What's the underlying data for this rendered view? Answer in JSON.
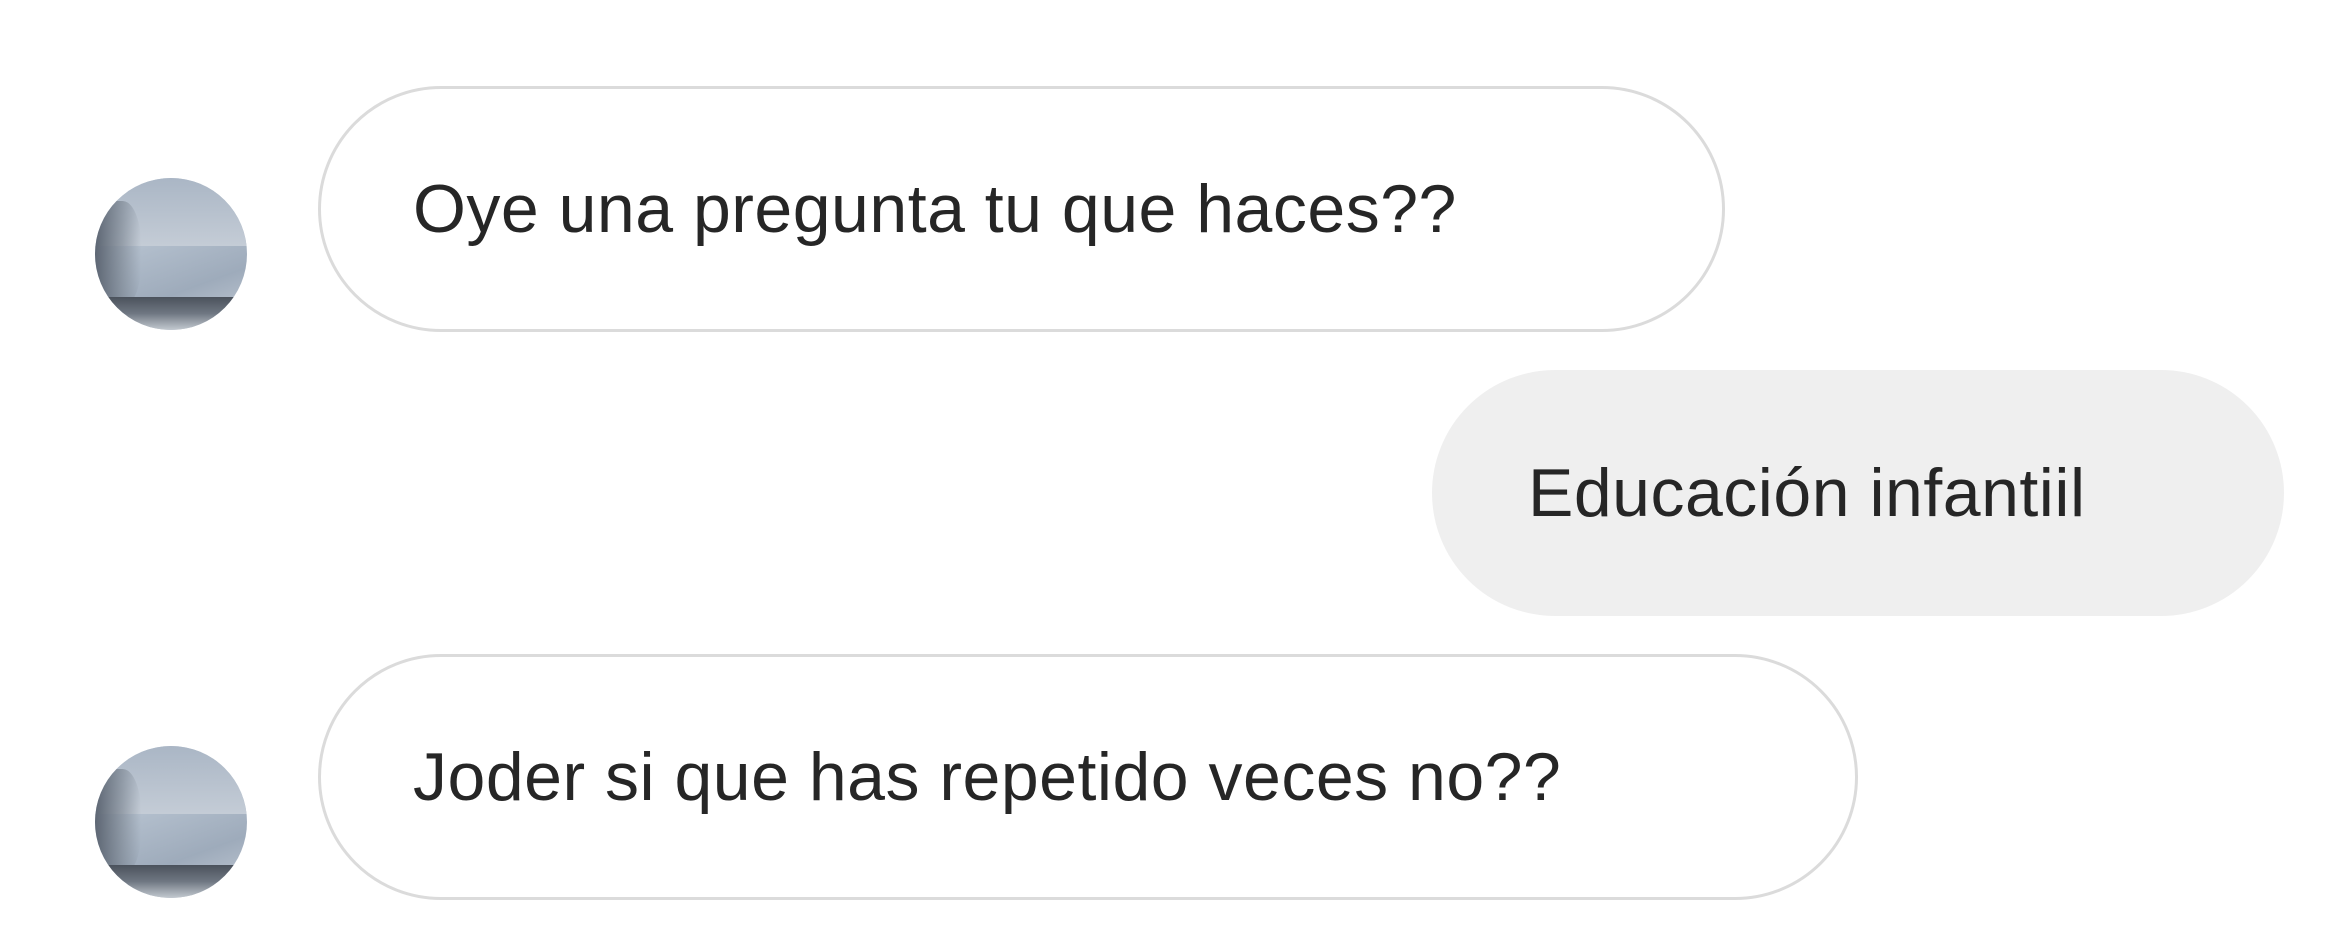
{
  "conversation": {
    "messages": [
      {
        "direction": "incoming",
        "text": "Oye una pregunta tu que haces??"
      },
      {
        "direction": "outgoing",
        "text": "Educación infantiil"
      },
      {
        "direction": "incoming",
        "text": "Joder si que has repetido veces no??"
      }
    ],
    "colors": {
      "incoming_bubble_bg": "#ffffff",
      "incoming_bubble_border": "#dbdbdb",
      "outgoing_bubble_bg": "#efefef",
      "text": "#262626"
    }
  }
}
